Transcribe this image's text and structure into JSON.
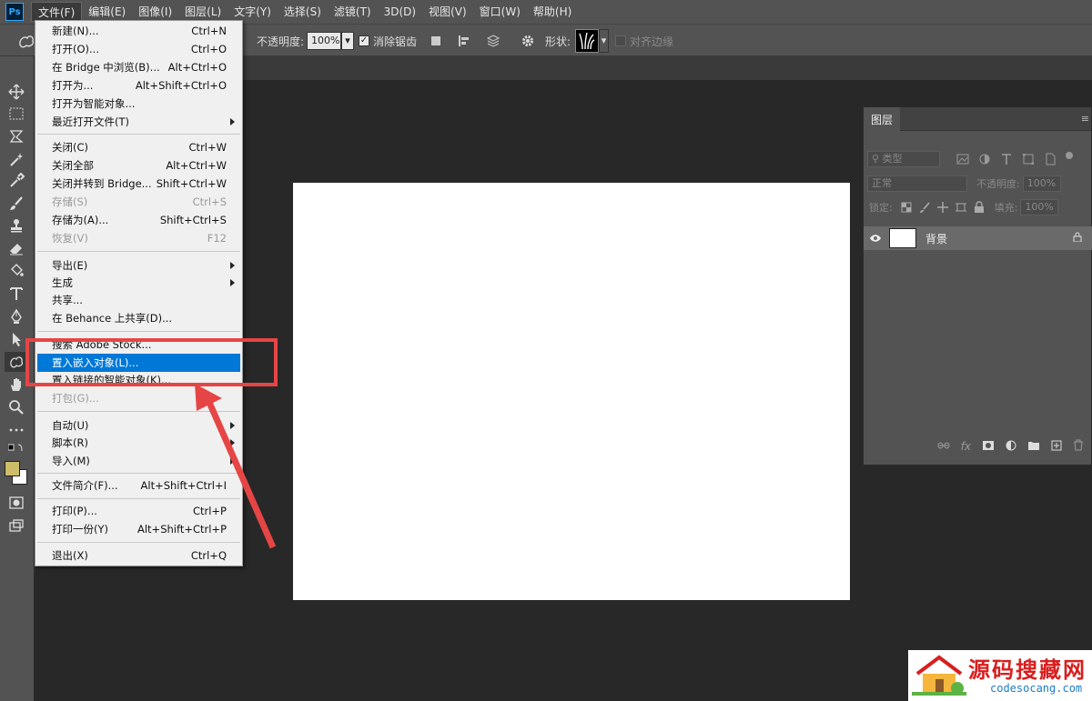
{
  "menubar": {
    "logo": "Ps",
    "items": [
      "文件(F)",
      "编辑(E)",
      "图像(I)",
      "图层(L)",
      "文字(Y)",
      "选择(S)",
      "滤镜(T)",
      "3D(D)",
      "视图(V)",
      "窗口(W)",
      "帮助(H)"
    ]
  },
  "options": {
    "opacity_label": "不透明度:",
    "opacity_value": "100%",
    "antialias_label": "消除锯齿",
    "shape_label": "形状:",
    "align_edges_label": "对齐边缘"
  },
  "file_menu": [
    {
      "label": "新建(N)...",
      "shortcut": "Ctrl+N"
    },
    {
      "label": "打开(O)...",
      "shortcut": "Ctrl+O"
    },
    {
      "label": "在 Bridge 中浏览(B)...",
      "shortcut": "Alt+Ctrl+O"
    },
    {
      "label": "打开为...",
      "shortcut": "Alt+Shift+Ctrl+O"
    },
    {
      "label": "打开为智能对象...",
      "shortcut": ""
    },
    {
      "label": "最近打开文件(T)",
      "shortcut": ""
    },
    {
      "label": "关闭(C)",
      "shortcut": "Ctrl+W"
    },
    {
      "label": "关闭全部",
      "shortcut": "Alt+Ctrl+W"
    },
    {
      "label": "关闭并转到 Bridge...",
      "shortcut": "Shift+Ctrl+W"
    },
    {
      "label": "存储(S)",
      "shortcut": "Ctrl+S"
    },
    {
      "label": "存储为(A)...",
      "shortcut": "Shift+Ctrl+S"
    },
    {
      "label": "恢复(V)",
      "shortcut": "F12"
    },
    {
      "label": "导出(E)",
      "shortcut": ""
    },
    {
      "label": "生成",
      "shortcut": ""
    },
    {
      "label": "共享...",
      "shortcut": ""
    },
    {
      "label": "在 Behance 上共享(D)...",
      "shortcut": ""
    },
    {
      "label": "搜索 Adobe Stock...",
      "shortcut": ""
    },
    {
      "label": "置入嵌入对象(L)...",
      "shortcut": ""
    },
    {
      "label": "置入链接的智能对象(K)...",
      "shortcut": ""
    },
    {
      "label": "打包(G)...",
      "shortcut": ""
    },
    {
      "label": "自动(U)",
      "shortcut": ""
    },
    {
      "label": "脚本(R)",
      "shortcut": ""
    },
    {
      "label": "导入(M)",
      "shortcut": ""
    },
    {
      "label": "文件简介(F)...",
      "shortcut": "Alt+Shift+Ctrl+I"
    },
    {
      "label": "打印(P)...",
      "shortcut": "Ctrl+P"
    },
    {
      "label": "打印一份(Y)",
      "shortcut": "Alt+Shift+Ctrl+P"
    },
    {
      "label": "退出(X)",
      "shortcut": "Ctrl+Q"
    }
  ],
  "layers_panel": {
    "tab": "图层",
    "filter_kind": "类型",
    "blend_mode": "正常",
    "opacity_label": "不透明度:",
    "opacity_value": "100%",
    "lock_label": "锁定:",
    "fill_label": "填充:",
    "fill_value": "100%",
    "layer_name": "背景"
  },
  "watermark": {
    "title": "源码搜藏网",
    "url": "codesocang.com"
  }
}
